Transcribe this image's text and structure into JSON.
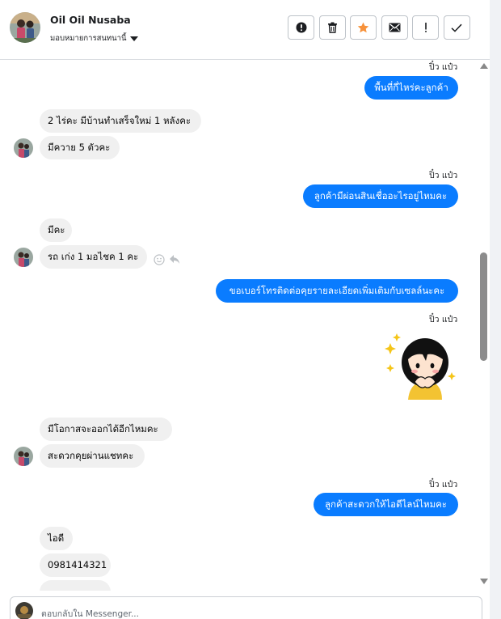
{
  "header": {
    "contact_name": "Oil Oil Nusaba",
    "assign_label": "มอบหมายการสนทนานี้",
    "actions": [
      {
        "name": "mark-spam-button",
        "icon": "alert-circle-icon"
      },
      {
        "name": "delete-button",
        "icon": "trash-icon"
      },
      {
        "name": "star-button",
        "icon": "star-icon",
        "color": "#f7923b"
      },
      {
        "name": "mark-unread-button",
        "icon": "envelope-icon"
      },
      {
        "name": "follow-up-button",
        "icon": "exclamation-icon"
      },
      {
        "name": "mark-done-button",
        "icon": "checkmark-icon"
      }
    ]
  },
  "thread": {
    "seen_label": "ปิ๋ว แป๋ว",
    "messages": [
      {
        "dir": "out",
        "text": "พื้นที่กี่ไหร่คะลูกค้า"
      },
      {
        "dir": "in",
        "text": "2 ไร่คะ มีบ้านทำเสร็จใหม่ 1 หลังคะ"
      },
      {
        "dir": "in",
        "text": "มีควาย  5 ตัวคะ"
      },
      {
        "dir": "out",
        "text": "ลูกค้ามีผ่อนสินเชื่ออะไรอยู่ไหมคะ"
      },
      {
        "dir": "in",
        "text": "มีคะ"
      },
      {
        "dir": "in",
        "text": "รถ เก่ง 1 มอไชค 1 คะ"
      },
      {
        "dir": "out",
        "text": "ขอเบอร์โทรติดต่อคุยรายละเอียดเพิ่มเติมกับเซลล์นะคะ"
      },
      {
        "dir": "out",
        "text": "sticker"
      },
      {
        "dir": "in",
        "text": "มีโอกาสจะออกได้อีกไหมคะ"
      },
      {
        "dir": "in",
        "text": "สะดวกคุยผ่านแชทคะ"
      },
      {
        "dir": "out",
        "text": "ลูกค้าสะดวกให้ไอดีไลน์ไหมคะ"
      },
      {
        "dir": "in",
        "text": "ไอดี"
      },
      {
        "dir": "in",
        "text": "0981414321"
      }
    ]
  },
  "composer": {
    "placeholder": "ตอบกลับใน Messenger..."
  },
  "colors": {
    "outgoing_bubble": "#0a7cff",
    "incoming_bubble": "#f0f0f0",
    "star": "#f7923b"
  }
}
